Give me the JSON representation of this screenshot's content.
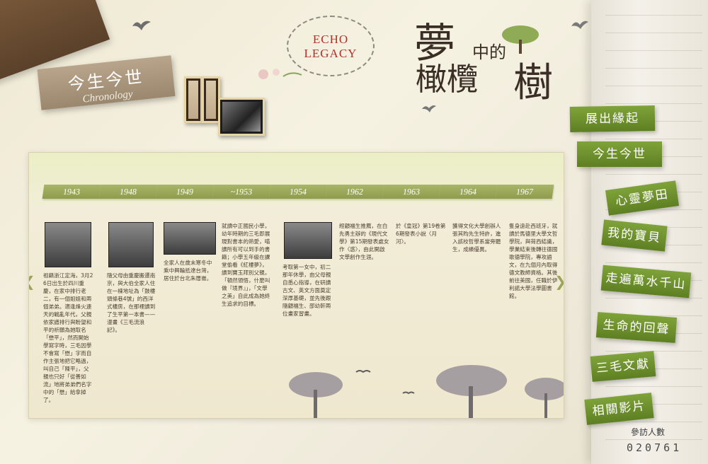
{
  "header": {
    "section_zh": "今生今世",
    "section_en": "Chronology",
    "echo_line1": "ECHO",
    "echo_line2": "LEGACY",
    "title_big1": "夢",
    "title_small": "中的",
    "title_big2": "橄欖",
    "title_big3": "樹"
  },
  "timeline": {
    "years": [
      "1943",
      "1948",
      "1949",
      "~1953",
      "1954",
      "1962",
      "1963",
      "1964",
      "1967"
    ],
    "entries": [
      "祖籍浙江定海，3月26日出生於四川重慶，在家中排行老二，有一個姐姐和兩個弟弟。適逢烽火連天的戰亂年代，父親依家譜排行與盼望和平的祈願為她取名「懋平」，然而開始學寫字時，三毛因學不會寫「懋」字而自作主張地把它略過，叫自己「陳平」，父親也只好「從善如流」地將弟弟們名字中的「懋」給拿掉了。",
      "隨父母由重慶搬遷南京，與大伯全家人住在一棟地址為「鼓樓頭條巷4號」的西洋式樓房，在那裡讀到了生平第一本書——漫畫《三毛流浪記》。",
      "全家人在歲末寒冬中乘中興輪抵達台灣，居住於台北朱厝崙。",
      "就讀中正國民小學，幼年時期的三毛即展現對書本的熱愛，喵讀所有可以到手的書籍；小學五年級在課堂偷看《紅樓夢》，讀到寶玉拜別父親，「頓然領悟，什麼叫做『境界』」，「文學之美」自此成為她終生追求的目標。",
      "考取第一女中，初二那年休學，由父母親自悉心指導，在研讀古文、英文方面奠定深厚基礎，並先後跟隨顧福生、邵幼軒兩位畫家習畫。",
      "經顧福生推薦，在白先勇主辦的《現代文學》第15期發表處女作〈惑〉，由此開啟文學創作生涯。",
      "於《皇冠》第19卷第6期發表小說〈月河〉。",
      "獲得文化大學創辦人張其昀先生特許，進入該校哲學系當旁聽生，成績優異。",
      "隻身遠赴西班牙，就讀於馬德里大學文哲學院，與荷西結識，學業結束後轉往德國歌德學院，專攻語文，在九個月內取得德文教師資格。其後前往美國，任職於伊利諾大學法學圖書館。"
    ]
  },
  "menu": {
    "items": [
      "展出緣起",
      "今生今世",
      "心靈夢田",
      "我的寶貝",
      "走遍萬水千山",
      "生命的回聲",
      "三毛文獻",
      "相關影片"
    ]
  },
  "counter": {
    "label": "參訪人數",
    "value": "020761"
  },
  "colors": {
    "menu_green": "#6f9130",
    "ribbon_green": "#9aa85a",
    "echo_red": "#b0312a",
    "label_taupe": "#a8957b"
  }
}
